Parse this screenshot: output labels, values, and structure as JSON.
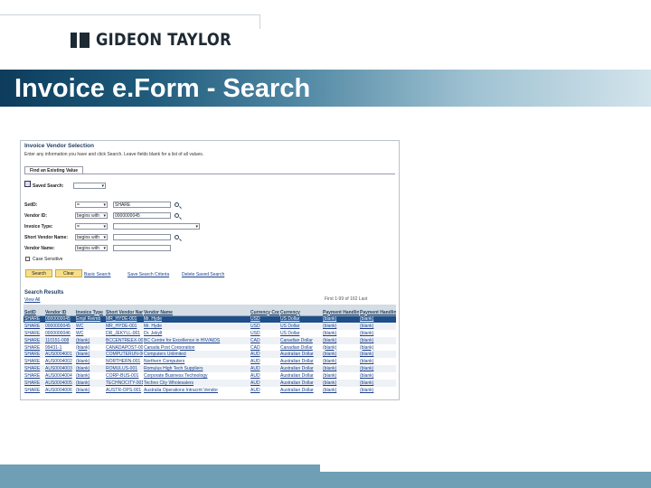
{
  "logo": {
    "text": "GIDEON TAYLOR"
  },
  "slide": {
    "title": "Invoice e.Form - Search"
  },
  "colors": {
    "title_band_dark": "#0d3c5c",
    "title_band_light": "#d3e4ec",
    "bottom_band": "#6f9fb5",
    "link": "#1a3f8a",
    "button": "#f7df8a"
  },
  "screen": {
    "title": "Invoice Vendor Selection",
    "instructions": "Enter any information you have and click Search. Leave fields blank for a list of all values.",
    "tab": "Find an Existing Value",
    "saved_search_label": "Saved Search:",
    "fields": [
      {
        "label": "SetID:",
        "operator": "=",
        "value": "SHARE"
      },
      {
        "label": "Vendor ID:",
        "operator": "begins with",
        "value": "0000000045"
      },
      {
        "label": "Invoice Type:",
        "operator": "=",
        "value": ""
      },
      {
        "label": "Short Vendor Name:",
        "operator": "begins with",
        "value": ""
      },
      {
        "label": "Vendor Name:",
        "operator": "begins with",
        "value": ""
      }
    ],
    "case_sensitive": "Case Sensitive",
    "buttons": {
      "search": "Search",
      "clear": "Clear"
    },
    "links": {
      "basic": "Basic Search",
      "save": "Save Search Criteria",
      "delete": "Delete Saved Search"
    },
    "results": {
      "title": "Search Results",
      "view_all": "View All",
      "pager": "First  1-99 of 162  Last",
      "columns": [
        "SetID",
        "Vendor ID",
        "Invoice Type",
        "Short Vendor Name",
        "Vendor Name",
        "Currency Code",
        "Currency",
        "Payment Handling",
        "Payment Handling"
      ],
      "rows": [
        [
          "SHARE",
          "0000000045",
          "Empl Reimb",
          "MR_HYDE-001",
          "Mr. Hyde",
          "USD",
          "US Dollar",
          "(blank)",
          "(blank)"
        ],
        [
          "SHARE",
          "0000000045",
          "WC",
          "MR_HYDE-001",
          "Mr. Hyde",
          "USD",
          "US Dollar",
          "(blank)",
          "(blank)"
        ],
        [
          "SHARE",
          "0000000046",
          "WC",
          "DR_JEKYLL-001",
          "Dr. Jekyll",
          "USD",
          "US Dollar",
          "(blank)",
          "(blank)"
        ],
        [
          "SHARE",
          "110151-008",
          "(blank)",
          "BCCENTREEX-001",
          "BC Centre for Excellence in HIV/AIDS",
          "CAD",
          "Canadian Dollar",
          "(blank)",
          "(blank)"
        ],
        [
          "SHARE",
          "99431-1",
          "(blank)",
          "CANADAPOST-001",
          "Canada Post Corporation",
          "CAD",
          "Canadian Dollar",
          "(blank)",
          "(blank)"
        ],
        [
          "SHARE",
          "AUS0004001",
          "(blank)",
          "COMPUTERUN-001",
          "Computers Unlimited",
          "AUD",
          "Australian Dollar",
          "(blank)",
          "(blank)"
        ],
        [
          "SHARE",
          "AUS0004002",
          "(blank)",
          "NORTHERN-001",
          "Northern Computers",
          "AUD",
          "Australian Dollar",
          "(blank)",
          "(blank)"
        ],
        [
          "SHARE",
          "AUS0004003",
          "(blank)",
          "ROMULUS-001",
          "Romulus High Tech Suppliers",
          "AUD",
          "Australian Dollar",
          "(blank)",
          "(blank)"
        ],
        [
          "SHARE",
          "AUS0004004",
          "(blank)",
          "CORP-BUS-001",
          "Corporate Business Technology",
          "AUD",
          "Australian Dollar",
          "(blank)",
          "(blank)"
        ],
        [
          "SHARE",
          "AUS0004005",
          "(blank)",
          "TECHNOCITY-001",
          "Techno City Wholesalers",
          "AUD",
          "Australian Dollar",
          "(blank)",
          "(blank)"
        ],
        [
          "SHARE",
          "AUS0004006",
          "(blank)",
          "AUSTR-OPS-001",
          "Australia Operations Intracmt Vendor",
          "AUD",
          "Australian Dollar",
          "(blank)",
          "(blank)"
        ]
      ]
    }
  }
}
